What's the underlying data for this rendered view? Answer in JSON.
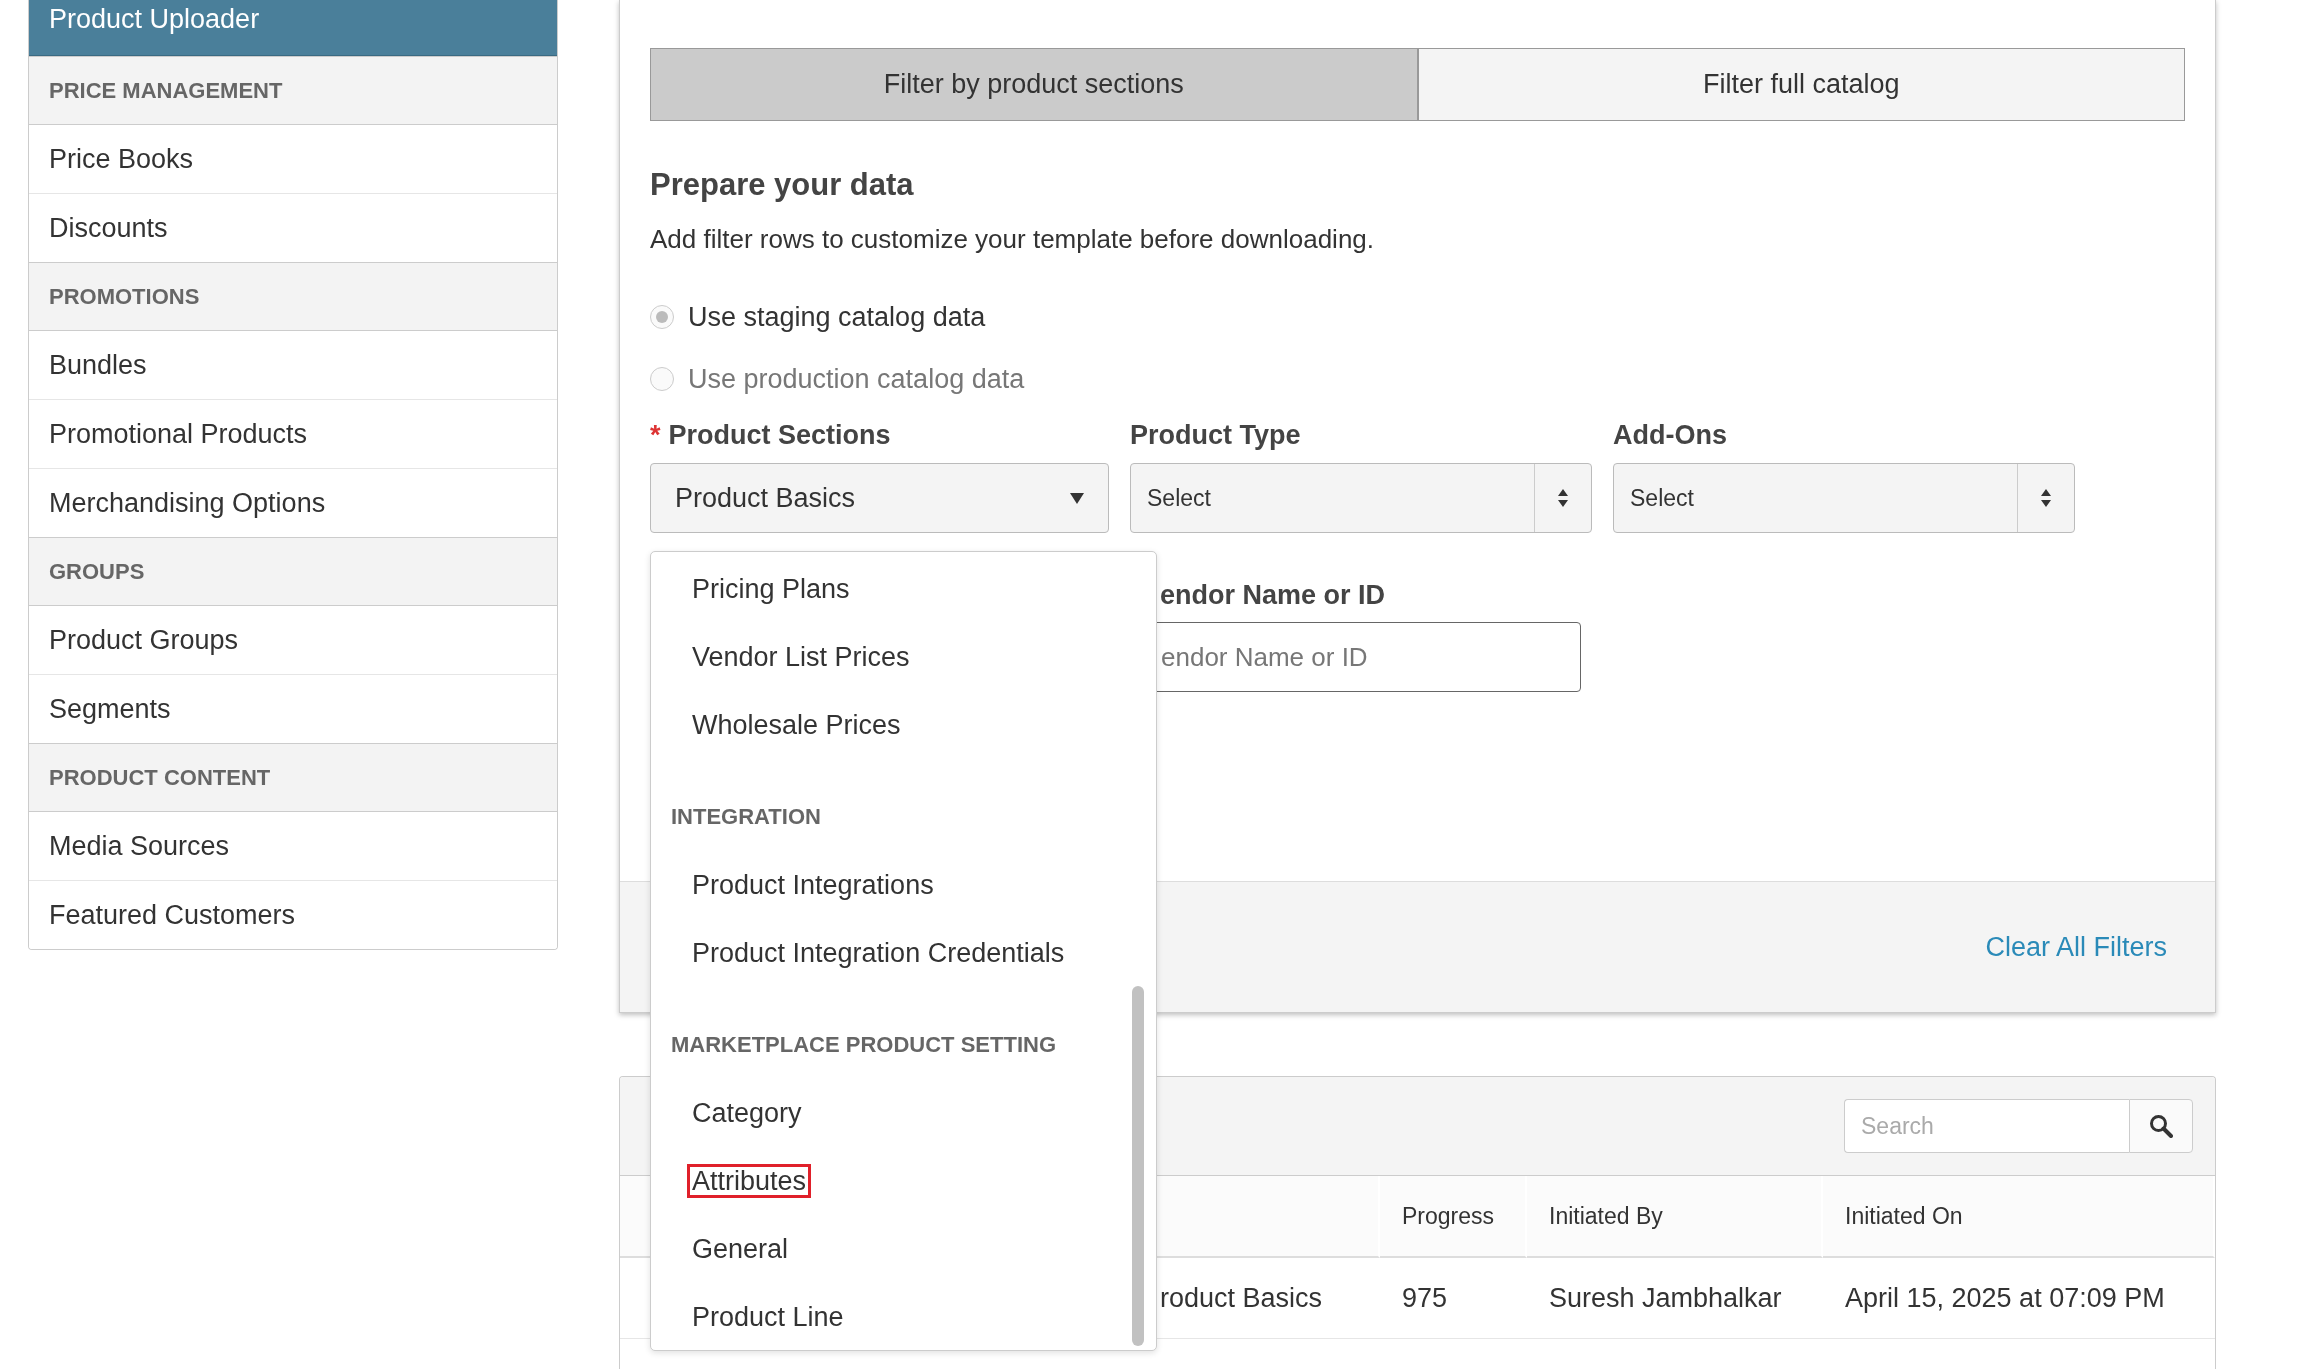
{
  "sidebar": {
    "items": [
      {
        "kind": "item",
        "label": "Product Uploader",
        "selected": true
      },
      {
        "kind": "header",
        "label": "PRICE MANAGEMENT"
      },
      {
        "kind": "item",
        "label": "Price Books",
        "selected": false
      },
      {
        "kind": "item",
        "label": "Discounts",
        "selected": false
      },
      {
        "kind": "header",
        "label": "PROMOTIONS"
      },
      {
        "kind": "item",
        "label": "Bundles",
        "selected": false
      },
      {
        "kind": "item",
        "label": "Promotional Products",
        "selected": false
      },
      {
        "kind": "item",
        "label": "Merchandising Options",
        "selected": false
      },
      {
        "kind": "header",
        "label": "GROUPS"
      },
      {
        "kind": "item",
        "label": "Product Groups",
        "selected": false
      },
      {
        "kind": "item",
        "label": "Segments",
        "selected": false
      },
      {
        "kind": "header",
        "label": "PRODUCT CONTENT"
      },
      {
        "kind": "item",
        "label": "Media Sources",
        "selected": false
      },
      {
        "kind": "item",
        "label": "Featured Customers",
        "selected": false
      }
    ]
  },
  "filter": {
    "tabs": [
      {
        "label": "Filter by product sections",
        "selected": true
      },
      {
        "label": "Filter full catalog",
        "selected": false
      }
    ],
    "heading": "Prepare your data",
    "description": "Add filter rows to customize your template before downloading.",
    "radios": [
      {
        "label": "Use staging catalog data",
        "selected": true
      },
      {
        "label": "Use production catalog data",
        "selected": false
      }
    ],
    "fields": [
      {
        "kind": "dropdown",
        "label": "Product Sections",
        "required_mark": "*",
        "value": "Product Basics"
      },
      {
        "kind": "select",
        "label": "Product Type",
        "value": "Select"
      },
      {
        "kind": "select",
        "label": "Add-Ons",
        "value": "Select"
      }
    ],
    "vendor": {
      "label": "endor Name or ID",
      "placeholder": "endor Name or ID"
    },
    "clear_link": "Clear All Filters",
    "dropdown": {
      "items": [
        {
          "kind": "option",
          "label": "Pricing Plans",
          "outlined": false
        },
        {
          "kind": "option",
          "label": "Vendor List Prices",
          "outlined": false
        },
        {
          "kind": "option",
          "label": "Wholesale Prices",
          "outlined": false
        },
        {
          "kind": "group",
          "label": "INTEGRATION"
        },
        {
          "kind": "option",
          "label": "Product Integrations",
          "outlined": false
        },
        {
          "kind": "option",
          "label": "Product Integration Credentials",
          "outlined": false
        },
        {
          "kind": "group",
          "label": "MARKETPLACE PRODUCT SETTING"
        },
        {
          "kind": "option",
          "label": "Category",
          "outlined": false
        },
        {
          "kind": "option",
          "label": "Attributes",
          "outlined": true
        },
        {
          "kind": "option",
          "label": "General",
          "outlined": false
        },
        {
          "kind": "option",
          "label": "Product Line",
          "outlined": false
        }
      ]
    }
  },
  "jobs": {
    "search": {
      "placeholder": "Search"
    },
    "columns": [
      "Progress",
      "Initiated By",
      "Initiated On"
    ],
    "rows": [
      {
        "column_1": "roduct Basics",
        "progress": "975",
        "initiated_by": "Suresh Jambhalkar",
        "initiated_on": "April 15, 2025 at 07:09 PM"
      }
    ]
  }
}
